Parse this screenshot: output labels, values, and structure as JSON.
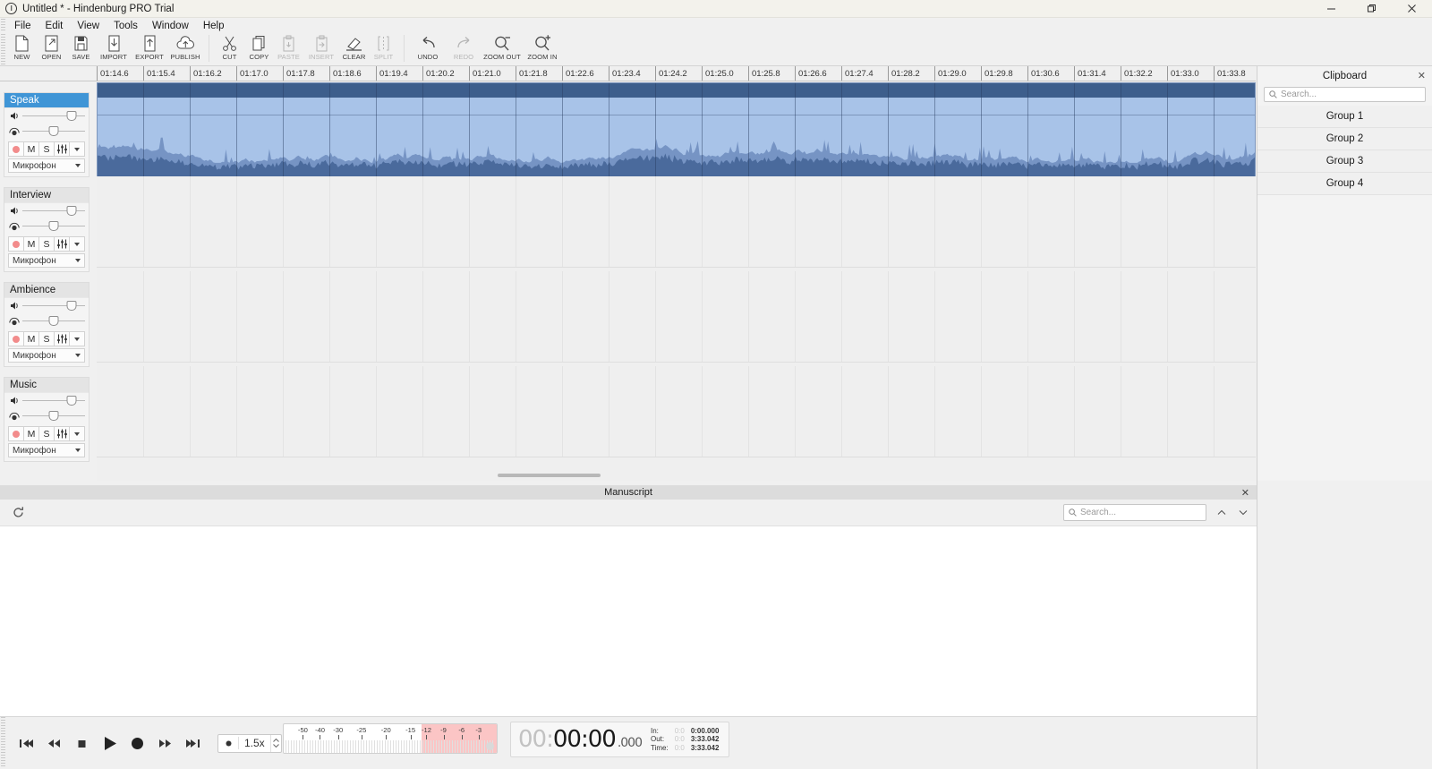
{
  "window": {
    "title": "Untitled * - Hindenburg PRO Trial",
    "app_icon": "hindenburg-logo-icon",
    "controls": {
      "minimize": "–",
      "restore": "❐",
      "close": "✕"
    }
  },
  "menubar": {
    "items": [
      "File",
      "Edit",
      "View",
      "Tools",
      "Window",
      "Help"
    ]
  },
  "toolbar": {
    "buttons": [
      {
        "label": "NEW",
        "icon": "new-document-icon",
        "enabled": true
      },
      {
        "label": "OPEN",
        "icon": "open-folder-icon",
        "enabled": true
      },
      {
        "label": "SAVE",
        "icon": "floppy-save-icon",
        "enabled": true
      },
      {
        "label": "IMPORT",
        "icon": "import-arrow-down-icon",
        "enabled": true
      },
      {
        "label": "EXPORT",
        "icon": "export-arrow-up-icon",
        "enabled": true
      },
      {
        "label": "PUBLISH",
        "icon": "cloud-upload-icon",
        "enabled": true
      },
      {
        "label": "CUT",
        "icon": "scissors-icon",
        "enabled": true
      },
      {
        "label": "COPY",
        "icon": "copy-icon",
        "enabled": true
      },
      {
        "label": "PASTE",
        "icon": "paste-icon",
        "enabled": false
      },
      {
        "label": "INSERT",
        "icon": "insert-icon",
        "enabled": false
      },
      {
        "label": "CLEAR",
        "icon": "eraser-icon",
        "enabled": true
      },
      {
        "label": "SPLIT",
        "icon": "split-icon",
        "enabled": false
      },
      {
        "label": "UNDO",
        "icon": "undo-arrow-icon",
        "enabled": true
      },
      {
        "label": "REDO",
        "icon": "redo-arrow-icon",
        "enabled": false
      },
      {
        "label": "ZOOM OUT",
        "icon": "magnifier-minus-icon",
        "enabled": true
      },
      {
        "label": "ZOOM IN",
        "icon": "magnifier-plus-icon",
        "enabled": true
      }
    ]
  },
  "ruler": {
    "ticks": [
      "01:14.6",
      "01:15.4",
      "01:16.2",
      "01:17.0",
      "01:17.8",
      "01:18.6",
      "01:19.4",
      "01:20.2",
      "01:21.0",
      "01:21.8",
      "01:22.6",
      "01:23.4",
      "01:24.2",
      "01:25.0",
      "01:25.8",
      "01:26.6",
      "01:27.4",
      "01:28.2",
      "01:29.0",
      "01:29.8",
      "01:30.6",
      "01:31.4",
      "01:32.2",
      "01:33.0",
      "01:33.8"
    ]
  },
  "tracks": [
    {
      "name": "Speak",
      "selected": true,
      "volume": 78,
      "pan": 50,
      "input": "Микрофон",
      "record": "record-arm-icon",
      "mute": "M",
      "solo": "S",
      "fx": "‖",
      "has_clip": true
    },
    {
      "name": "Interview",
      "selected": false,
      "volume": 78,
      "pan": 50,
      "input": "Микрофон",
      "record": "record-arm-icon",
      "mute": "M",
      "solo": "S",
      "fx": "‖",
      "has_clip": false
    },
    {
      "name": "Ambience",
      "selected": false,
      "volume": 78,
      "pan": 50,
      "input": "Микрофон",
      "record": "record-arm-icon",
      "mute": "M",
      "solo": "S",
      "fx": "‖",
      "has_clip": false
    },
    {
      "name": "Music",
      "selected": false,
      "volume": 78,
      "pan": 50,
      "input": "Микрофон",
      "record": "record-arm-icon",
      "mute": "M",
      "solo": "S",
      "fx": "‖",
      "has_clip": false
    }
  ],
  "clipboard": {
    "title": "Clipboard",
    "close": "✕",
    "search_placeholder": "Search...",
    "groups": [
      "Group 1",
      "Group 2",
      "Group 3",
      "Group 4"
    ]
  },
  "manuscript": {
    "title": "Manuscript",
    "close": "✕",
    "refresh_icon": "refresh-icon",
    "search_placeholder": "Search...",
    "prev_icon": "chevron-up-icon",
    "next_icon": "chevron-down-icon"
  },
  "transport": {
    "buttons": [
      {
        "name": "go-to-start-button",
        "icon": "skip-back-icon"
      },
      {
        "name": "rewind-button",
        "icon": "rewind-icon"
      },
      {
        "name": "stop-button",
        "icon": "stop-icon"
      },
      {
        "name": "play-button",
        "icon": "play-icon"
      },
      {
        "name": "record-button",
        "icon": "record-icon"
      },
      {
        "name": "fast-forward-button",
        "icon": "fast-forward-icon"
      },
      {
        "name": "go-to-end-button",
        "icon": "skip-forward-icon"
      }
    ],
    "speed": {
      "value": "1.5x",
      "dot_icon": "dot-icon"
    }
  },
  "meter": {
    "labels": [
      "-50",
      "-40",
      "-30",
      "-25",
      "-20",
      "-15",
      "-12",
      "-9",
      "-6",
      "-3"
    ],
    "red_start_db": -9
  },
  "timecode": {
    "hours": "00",
    "minutes": "00",
    "seconds": "00",
    "millis": ".000",
    "sep": ":",
    "rows": [
      {
        "label": "In:",
        "dim": "0:0",
        "value": "0:00.000"
      },
      {
        "label": "Out:",
        "dim": "0:0",
        "value": "3:33.042"
      },
      {
        "label": "Time:",
        "dim": "0:0",
        "value": "3:33.042"
      }
    ]
  },
  "colors": {
    "accent": "#3f95d6",
    "clip_header": "#3d5e8c",
    "clip_body": "#a8c3e8",
    "wave_dark": "#4a6a9c",
    "wave_light": "#7694c4",
    "meter_red": "#fbc5c5"
  }
}
